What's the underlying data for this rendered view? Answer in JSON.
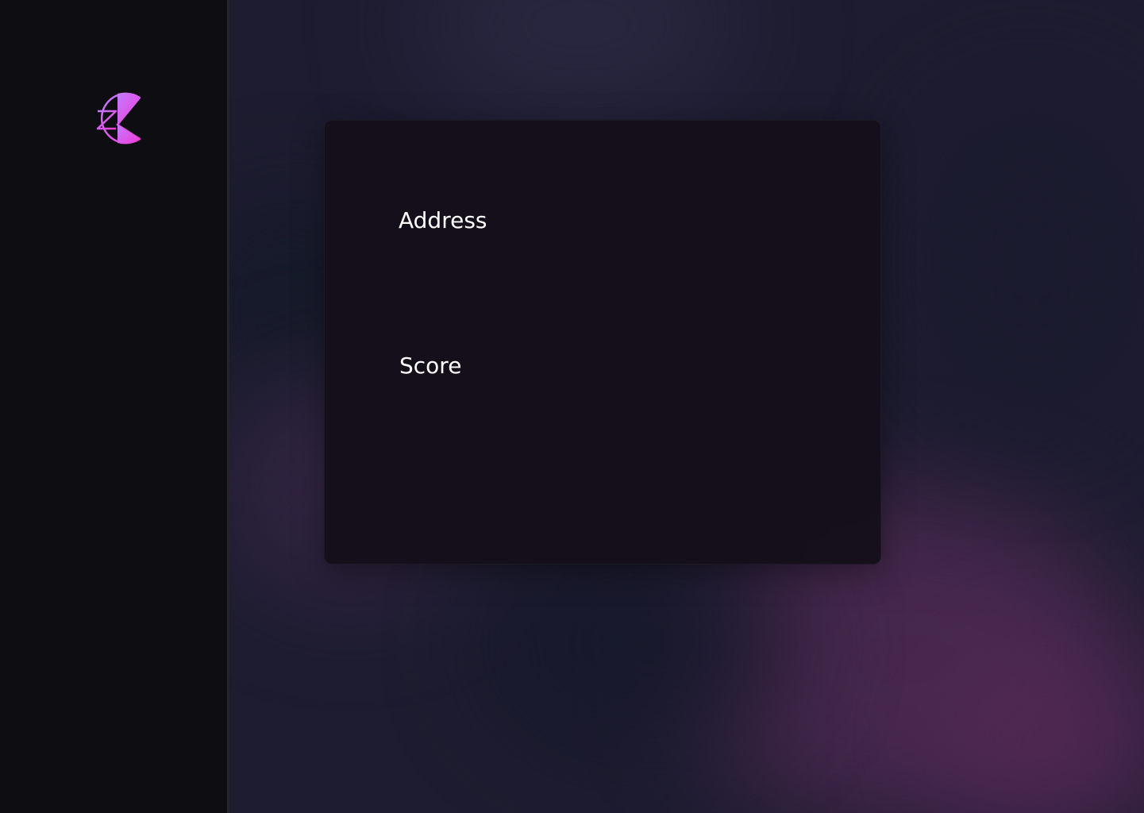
{
  "sidebar": {
    "logo_icon": "z-pie-logo-icon"
  },
  "card": {
    "address_label": "Address",
    "score_label": "Score"
  },
  "colors": {
    "sidebar_bg": "#0e0e12",
    "card_bg": "#140f1a",
    "logo_gradient_start": "#c27cff",
    "logo_gradient_end": "#f03ad8",
    "text": "#ffffff"
  }
}
